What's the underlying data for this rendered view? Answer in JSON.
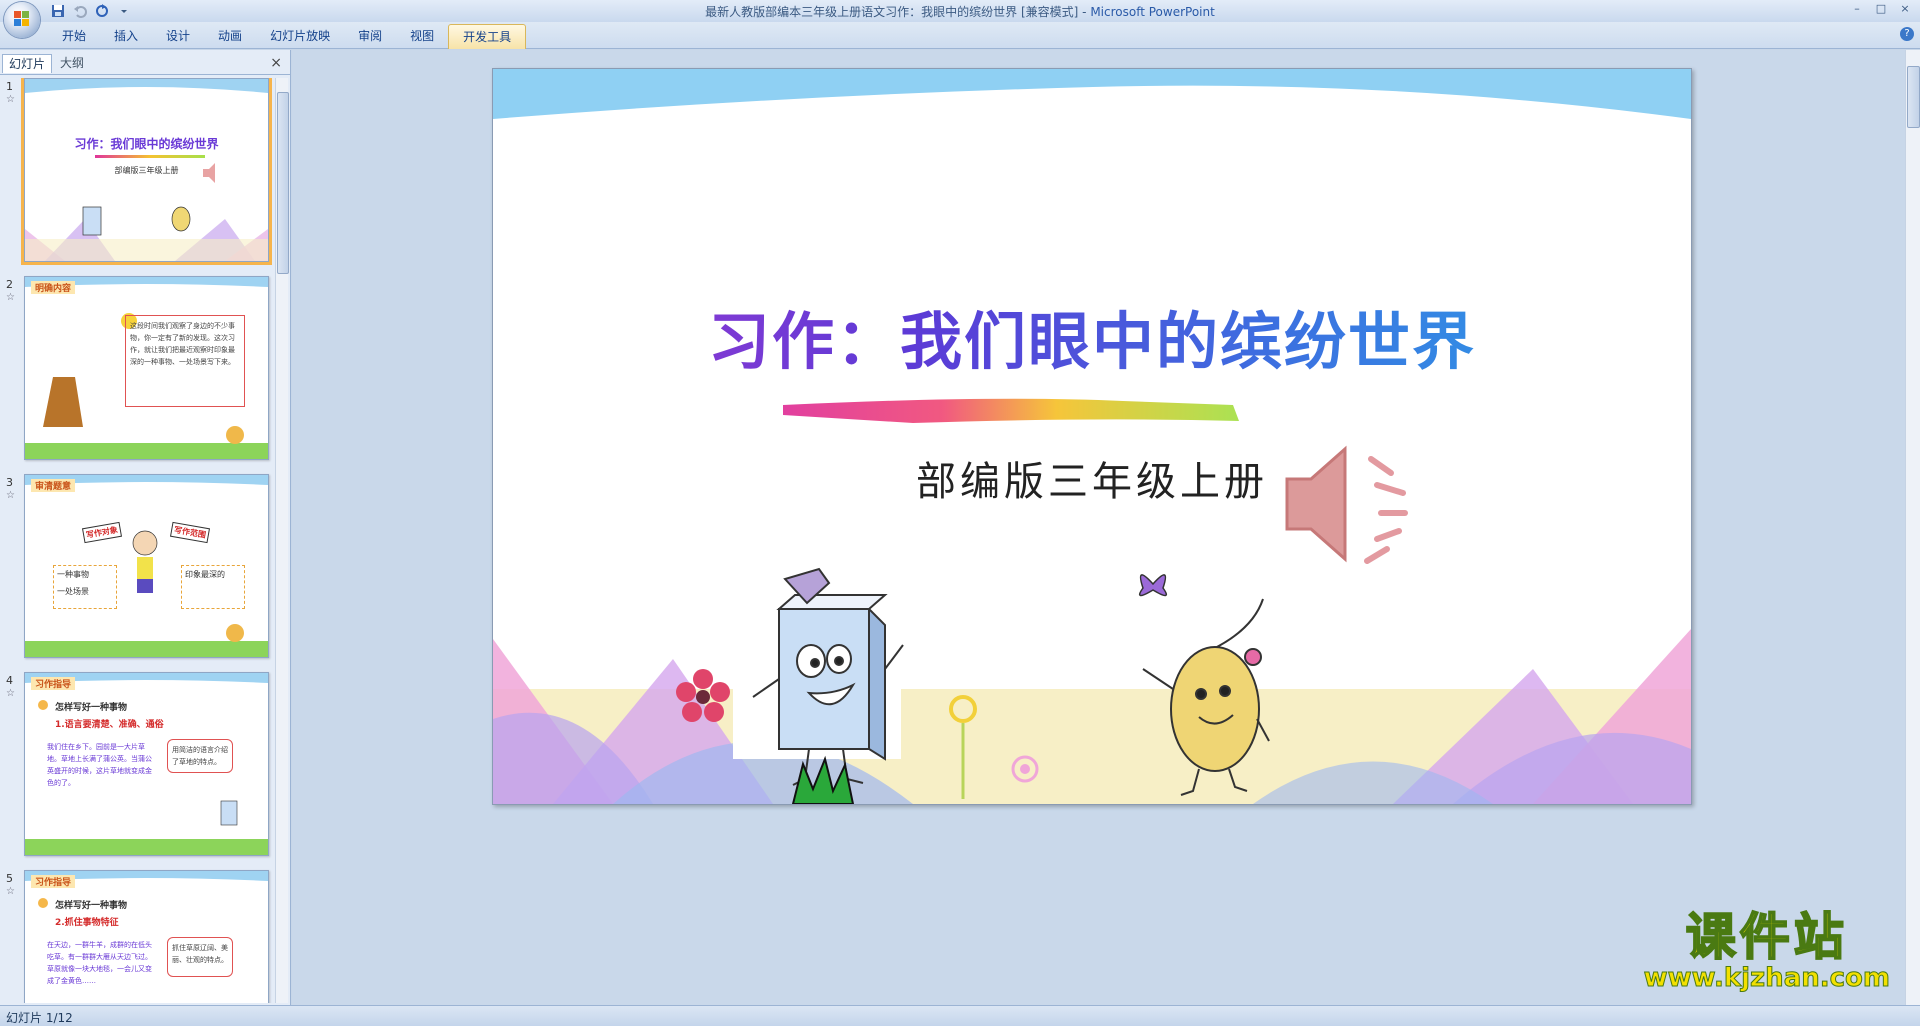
{
  "window": {
    "title": "最新人教版部编本三年级上册语文习作：我眼中的缤纷世界 [兼容模式]",
    "title_sep": " - ",
    "app_name": "Microsoft PowerPoint",
    "controls": [
      "–",
      "□",
      "×"
    ]
  },
  "qat": {
    "icons": [
      "save-icon",
      "undo-icon",
      "redo-icon",
      "dropdown-icon"
    ]
  },
  "ribbon": {
    "tabs": [
      "开始",
      "插入",
      "设计",
      "动画",
      "幻灯片放映",
      "审阅",
      "视图",
      "开发工具"
    ],
    "active_tab": "开发工具"
  },
  "left_pane": {
    "tab_slides": "幻灯片",
    "tab_outline": "大纲",
    "close": "×",
    "thumbnails": [
      {
        "num": "1",
        "title": "习作：我们眼中的缤纷世界",
        "subtitle": "部编版三年级上册"
      },
      {
        "num": "2",
        "tag": "明确内容",
        "text": "这段时间我们观察了身边的不少事物，你一定有了新的发现。这次习作，就让我们把最近观察时印象最深的一种事物、一处场景写下来。"
      },
      {
        "num": "3",
        "tag": "审清题意",
        "sign1": "写作对象",
        "sign2": "写作范围",
        "box1_line1": "一种事物",
        "box1_line2": "一处场景",
        "box2": "印象最深的"
      },
      {
        "num": "4",
        "tag": "习作指导",
        "heading": "怎样写好一种事物",
        "point": "1.语言要清楚、准确、通俗",
        "para": "我们住在乡下。园前是一大片草地。草地上长满了蒲公英。当蒲公英盛开的时候，这片草地就变成金色的了。",
        "bubble": "用简洁的语言介绍了草地的特点。"
      },
      {
        "num": "5",
        "tag": "习作指导",
        "heading": "怎样写好一种事物",
        "point": "2.抓住事物特征",
        "para": "在天边，一群牛羊，成群的在低头吃草。有一群群大雁从天边飞过。草原就像一块大地毯，一会儿又变成了金黄色……",
        "bubble": "抓住草原辽阔、美丽、壮观的特点。"
      }
    ]
  },
  "slide": {
    "title": "习作：我们眼中的缤纷世界",
    "subtitle": "部编版三年级上册"
  },
  "status": {
    "text": "幻灯片 1/12"
  },
  "watermark": {
    "cn": "课件站",
    "url": "www.kjzhan.com"
  },
  "colors": {
    "title_gradient_start": "#a43bd2",
    "title_gradient_end": "#2aa8e8",
    "selection": "#f6b44c",
    "ribbon_bg": "#cddcef"
  }
}
